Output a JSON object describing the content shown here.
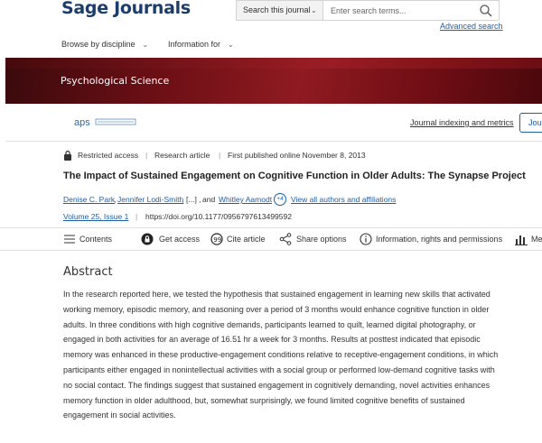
{
  "header": {
    "logo": "Sage Journals",
    "search_scope": "Search this journal",
    "search_placeholder": "Enter search terms...",
    "advanced_search": "Advanced search"
  },
  "nav": {
    "browse": "Browse by discipline",
    "information": "Information for"
  },
  "banner": {
    "title": "Psychological Science"
  },
  "journal": {
    "logo_text": "aps",
    "indexing_link": "Journal indexing and metrics",
    "journal_button": "Jou"
  },
  "meta": {
    "access": "Restricted access",
    "type": "Research article",
    "published": "First published online November 8, 2013"
  },
  "article": {
    "title": "The Impact of Sustained Engagement on Cognitive Function in Older Adults: The Synapse Project",
    "author1": "Denise C. Park",
    "author2": "Jennifer Lodi-Smith",
    "ellipsis": "[...]",
    "and": "and",
    "author3": "Whitley Aamodt",
    "more_count": "+4",
    "view_all": "View all authors and affiliations",
    "volume": "Volume 25, Issue 1",
    "doi": "https://doi.org/10.1177/0956797613499592"
  },
  "toolbar": {
    "contents": "Contents",
    "get_access": "Get access",
    "cite": "Cite article",
    "share": "Share options",
    "info": "Information, rights and permissions",
    "metrics": "Me"
  },
  "abstract": {
    "heading": "Abstract",
    "text": "In the research reported here, we tested the hypothesis that sustained engagement in learning new skills that activated working memory, episodic memory, and reasoning over a period of 3 months would enhance cognitive function in older adults. In three conditions with high cognitive demands, participants learned to quilt, learned digital photography, or engaged in both activities for an average of 16.51 hr a week for 3 months. Results at posttest indicated that episodic memory was enhanced in these productive-engagement conditions relative to receptive-engagement conditions, in which participants either engaged in nonintellectual activities with a social group or performed low-demand cognitive tasks with no social contact. The findings suggest that sustained engagement in cognitively demanding, novel activities enhances memory function in older adulthood, but, somewhat surprisingly, we found limited cognitive benefits of sustained engagement in social activities."
  },
  "colors": {
    "brand_navy": "#1c3d6b",
    "link_blue": "#1d5ea8",
    "banner_red": "#8f1a21"
  }
}
